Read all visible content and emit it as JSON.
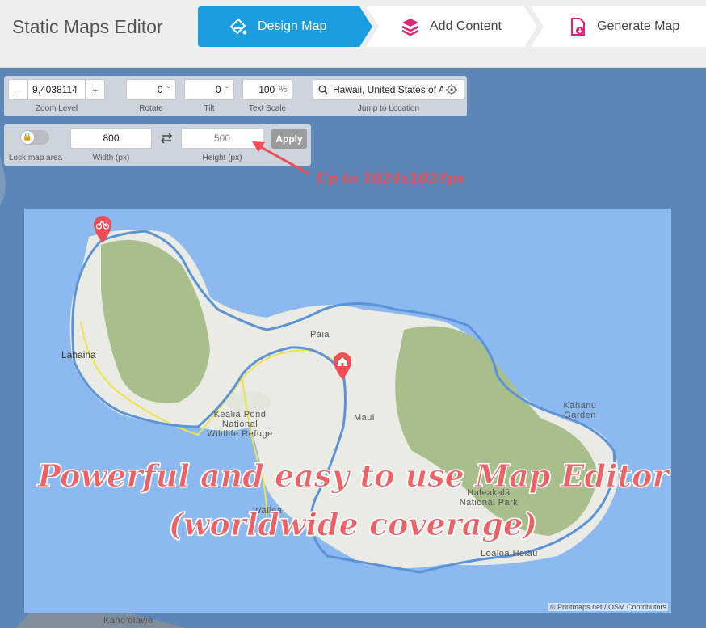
{
  "app": {
    "title": "Static Maps Editor"
  },
  "steps": [
    {
      "label": "Design Map",
      "icon": "paint-bucket-icon",
      "active": true
    },
    {
      "label": "Add Content",
      "icon": "layers-icon",
      "active": false
    },
    {
      "label": "Generate Map",
      "icon": "download-page-icon",
      "active": false
    }
  ],
  "controls": {
    "zoom": {
      "minus": "-",
      "value": "9,4038114",
      "plus": "+",
      "label": "Zoom Level"
    },
    "rotate": {
      "value": "0",
      "unit": "°",
      "label": "Rotate"
    },
    "tilt": {
      "value": "0",
      "unit": "°",
      "label": "Tilt"
    },
    "text_scale": {
      "value": "100",
      "unit": "%",
      "label": "Text Scale"
    },
    "location": {
      "value": "Hawaii, United States of A",
      "label": "Jump to Location"
    },
    "lock": {
      "label": "Lock map area"
    },
    "width": {
      "value": "800",
      "label": "Width (px)"
    },
    "height": {
      "placeholder": "500",
      "label": "Height (px)"
    },
    "apply_label": "Apply"
  },
  "annotation": "Up to 1024x1024px",
  "map": {
    "labels": {
      "lahaina": "Lahaina",
      "paia": "Paia",
      "maui": "Maui",
      "kealia_1": "Keālia Pond",
      "kealia_2": "National",
      "kealia_3": "Wildlife Refuge",
      "kahanu_1": "Kahanu",
      "kahanu_2": "Garden",
      "haleakala_1": "Haleakalā",
      "haleakala_2": "National Park",
      "wailea": "Wailea",
      "loaloa": "Loaloa Heiau",
      "kahoolawe": "Kaho'olawe"
    },
    "attribution": "© Printmaps.net / OSM Contributors",
    "colors": {
      "water": "#8cbaf0",
      "land": "#e9ebe4",
      "park": "#a8bf8c",
      "route": "#5b93d8",
      "road": "#f2e24a",
      "marker": "#ee4d55"
    }
  },
  "promo": {
    "line1": "Powerful and easy to use Map Editor",
    "line2": "(worldwide coverage)"
  },
  "colors": {
    "accent": "#1a9ee0",
    "annotation": "#ee4d55"
  }
}
